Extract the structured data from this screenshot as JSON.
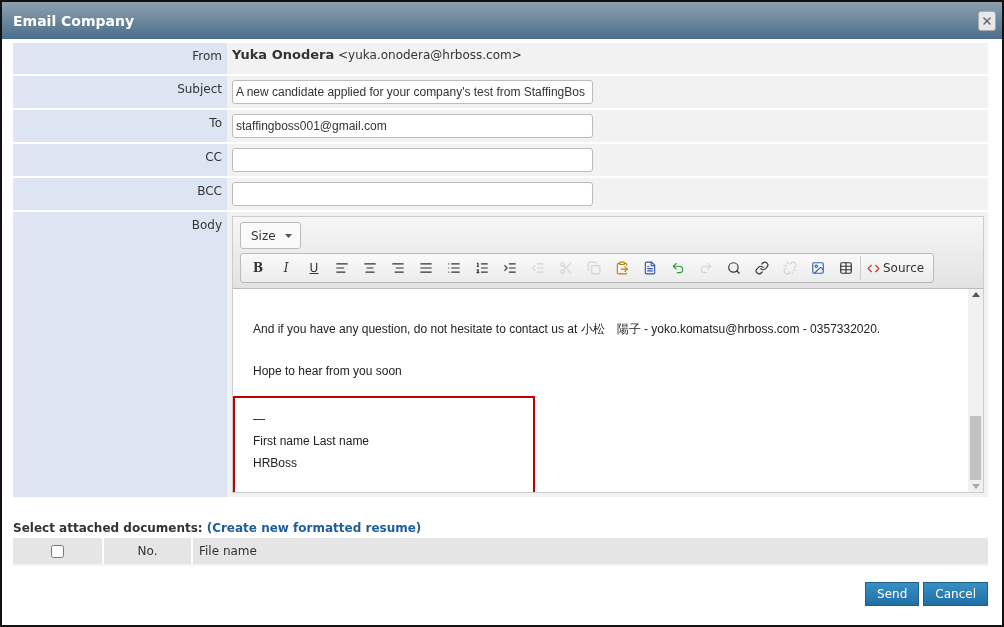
{
  "window": {
    "title": "Email Company"
  },
  "fields": [
    {
      "label": "From",
      "kind": "sender",
      "name": "Yuka Onodera",
      "address": "<yuka.onodera@hrboss.com>"
    },
    {
      "label": "Subject",
      "kind": "input",
      "value": "A new candidate applied for your company's test from StaffingBos"
    },
    {
      "label": "To",
      "kind": "input",
      "value": "staffingboss001@gmail.com"
    },
    {
      "label": "CC",
      "kind": "input"
    },
    {
      "label": "BCC",
      "kind": "input"
    }
  ],
  "body": {
    "label": "Body",
    "size_dropdown": "Size",
    "tools": [
      {
        "kind": "bold",
        "label": "B",
        "disabled": false
      },
      {
        "kind": "italic",
        "label": "I",
        "disabled": false
      },
      {
        "kind": "underline",
        "label": "U",
        "disabled": false
      },
      {
        "kind": "align-left",
        "disabled": false
      },
      {
        "kind": "align-center",
        "disabled": false
      },
      {
        "kind": "align-right",
        "disabled": false
      },
      {
        "kind": "justify",
        "disabled": false
      },
      {
        "kind": "bullets",
        "disabled": false
      },
      {
        "kind": "numbers",
        "disabled": false
      },
      {
        "kind": "indent",
        "disabled": false
      },
      {
        "kind": "outdent",
        "disabled": true
      },
      {
        "kind": "cut",
        "disabled": true
      },
      {
        "kind": "copy",
        "disabled": true
      },
      {
        "kind": "paste",
        "disabled": false
      },
      {
        "kind": "paste-word",
        "disabled": false
      },
      {
        "kind": "undo",
        "disabled": false
      },
      {
        "kind": "redo",
        "disabled": true
      },
      {
        "kind": "find",
        "disabled": false
      },
      {
        "kind": "link",
        "disabled": false
      },
      {
        "kind": "unlink",
        "disabled": true
      },
      {
        "kind": "image",
        "disabled": false
      },
      {
        "kind": "table",
        "disabled": false
      },
      {
        "kind": "source",
        "label": "Source",
        "disabled": false
      }
    ],
    "paragraphs": [
      "And if you have any question, do not hesitate to contact us at 小松　陽子 - yoko.komatsu@hrboss.com - 0357332020.",
      "Hope to hear from you soon"
    ],
    "signature": [
      "—",
      "First name Last name",
      "HRBoss"
    ]
  },
  "attachments": {
    "label": "Select attached documents:",
    "link": "(Create new formatted resume)",
    "select_all_checked": false,
    "columns": [
      "No.",
      "File name"
    ]
  },
  "buttons": [
    "Send",
    "Cancel"
  ]
}
